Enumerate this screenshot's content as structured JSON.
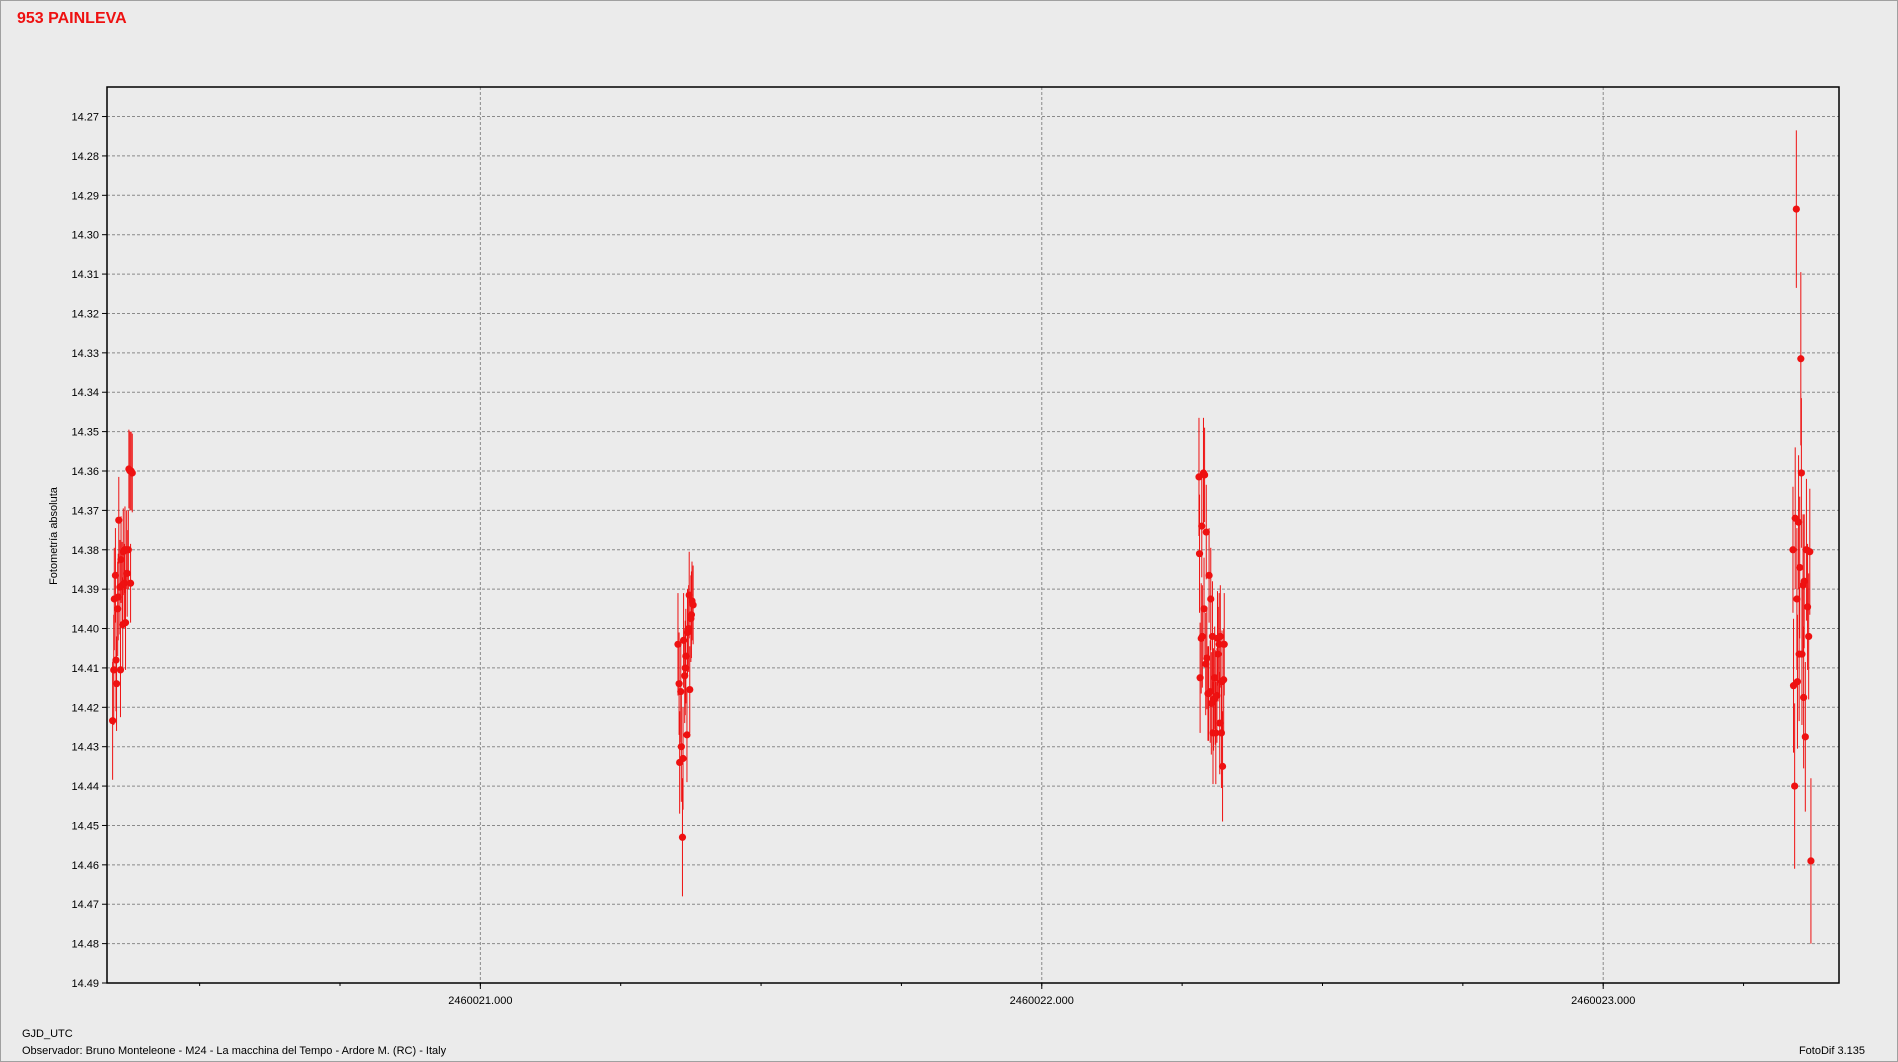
{
  "title": "953 PAINLEVA",
  "footer": {
    "xlabel": "GJD_UTC",
    "observer": "Observador: Bruno Monteleone - M24 - La macchina del Tempo - Ardore M. (RC) - Italy",
    "software": "FotoDif 3.135"
  },
  "chart_data": {
    "type": "scatter",
    "title": "953 PAINLEVA",
    "xlabel": "GJD_UTC",
    "ylabel": "Fotometría absoluta",
    "y_inverted": true,
    "grid": true,
    "xlim": [
      2460020.335,
      2460023.42
    ],
    "ylim": [
      14.2625,
      14.49
    ],
    "x_ticks": [
      2460021.0,
      2460022.0,
      2460023.0
    ],
    "x_tick_labels": [
      "2460021.000",
      "2460022.000",
      "2460023.000"
    ],
    "y_ticks": [
      14.27,
      14.28,
      14.29,
      14.3,
      14.31,
      14.32,
      14.33,
      14.34,
      14.35,
      14.36,
      14.37,
      14.38,
      14.39,
      14.4,
      14.41,
      14.42,
      14.43,
      14.44,
      14.45,
      14.46,
      14.47,
      14.48,
      14.49
    ],
    "y_tick_labels": [
      "14.27",
      "14.28",
      "14.29",
      "14.30",
      "14.31",
      "14.32",
      "14.33",
      "14.34",
      "14.35",
      "14.36",
      "14.37",
      "14.38",
      "14.39",
      "14.40",
      "14.41",
      "14.42",
      "14.43",
      "14.44",
      "14.45",
      "14.46",
      "14.47",
      "14.48",
      "14.49"
    ],
    "marker_color": "#ee1111",
    "series": [
      {
        "points": [
          [
            2460020.345,
            14.4234,
            0.015
          ],
          [
            2460020.347,
            14.4105,
            0.014
          ],
          [
            2460020.348,
            14.3925,
            0.013
          ],
          [
            2460020.35,
            14.3865,
            0.012
          ],
          [
            2460020.351,
            14.408,
            0.013
          ],
          [
            2460020.352,
            14.414,
            0.012
          ],
          [
            2460020.354,
            14.395,
            0.012
          ],
          [
            2460020.355,
            14.392,
            0.011
          ],
          [
            2460020.356,
            14.3725,
            0.011
          ],
          [
            2460020.358,
            14.3895,
            0.012
          ],
          [
            2460020.359,
            14.4105,
            0.012
          ],
          [
            2460020.36,
            14.3825,
            0.011
          ],
          [
            2460020.362,
            14.389,
            0.011
          ],
          [
            2460020.363,
            14.399,
            0.012
          ],
          [
            2460020.364,
            14.3805,
            0.011
          ],
          [
            2460020.366,
            14.3885,
            0.01
          ],
          [
            2460020.367,
            14.38,
            0.011
          ],
          [
            2460020.368,
            14.3985,
            0.012
          ],
          [
            2460020.37,
            14.38,
            0.01
          ],
          [
            2460020.371,
            14.386,
            0.011
          ],
          [
            2460020.373,
            14.38,
            0.01
          ],
          [
            2460020.374,
            14.3595,
            0.01
          ],
          [
            2460020.376,
            14.36,
            0.01
          ],
          [
            2460020.377,
            14.3885,
            0.01
          ],
          [
            2460020.378,
            14.36,
            0.01
          ],
          [
            2460020.38,
            14.3605,
            0.01
          ],
          [
            2460021.352,
            14.404,
            0.013
          ],
          [
            2460021.354,
            14.414,
            0.013
          ],
          [
            2460021.355,
            14.434,
            0.013
          ],
          [
            2460021.357,
            14.416,
            0.013
          ],
          [
            2460021.358,
            14.43,
            0.014
          ],
          [
            2460021.36,
            14.453,
            0.015
          ],
          [
            2460021.361,
            14.433,
            0.013
          ],
          [
            2460021.362,
            14.403,
            0.012
          ],
          [
            2460021.364,
            14.412,
            0.012
          ],
          [
            2460021.365,
            14.41,
            0.012
          ],
          [
            2460021.366,
            14.407,
            0.012
          ],
          [
            2460021.368,
            14.427,
            0.012
          ],
          [
            2460021.369,
            14.401,
            0.011
          ],
          [
            2460021.371,
            14.4,
            0.011
          ],
          [
            2460021.372,
            14.3915,
            0.011
          ],
          [
            2460021.373,
            14.4155,
            0.011
          ],
          [
            2460021.375,
            14.3975,
            0.011
          ],
          [
            2460021.376,
            14.3965,
            0.011
          ],
          [
            2460021.377,
            14.393,
            0.01
          ],
          [
            2460021.379,
            14.394,
            0.01
          ],
          [
            2460022.28,
            14.3615,
            0.015
          ],
          [
            2460022.281,
            14.381,
            0.015
          ],
          [
            2460022.282,
            14.4125,
            0.014
          ],
          [
            2460022.284,
            14.4025,
            0.014
          ],
          [
            2460022.285,
            14.374,
            0.013
          ],
          [
            2460022.286,
            14.402,
            0.013
          ],
          [
            2460022.288,
            14.3605,
            0.014
          ],
          [
            2460022.289,
            14.395,
            0.013
          ],
          [
            2460022.29,
            14.361,
            0.012
          ],
          [
            2460022.292,
            14.409,
            0.013
          ],
          [
            2460022.293,
            14.3755,
            0.012
          ],
          [
            2460022.294,
            14.4075,
            0.013
          ],
          [
            2460022.296,
            14.4165,
            0.012
          ],
          [
            2460022.297,
            14.4165,
            0.012
          ],
          [
            2460022.298,
            14.3865,
            0.012
          ],
          [
            2460022.3,
            14.416,
            0.013
          ],
          [
            2460022.301,
            14.3925,
            0.013
          ],
          [
            2460022.302,
            14.419,
            0.013
          ],
          [
            2460022.304,
            14.402,
            0.014
          ],
          [
            2460022.305,
            14.4265,
            0.013
          ],
          [
            2460022.306,
            14.418,
            0.013
          ],
          [
            2460022.308,
            14.4125,
            0.013
          ],
          [
            2460022.309,
            14.4175,
            0.012
          ],
          [
            2460022.31,
            14.4265,
            0.013
          ],
          [
            2460022.312,
            14.417,
            0.012
          ],
          [
            2460022.313,
            14.4025,
            0.012
          ],
          [
            2460022.314,
            14.4065,
            0.012
          ],
          [
            2460022.316,
            14.404,
            0.013
          ],
          [
            2460022.317,
            14.424,
            0.013
          ],
          [
            2460022.318,
            14.402,
            0.013
          ],
          [
            2460022.32,
            14.4265,
            0.014
          ],
          [
            2460022.321,
            14.4135,
            0.013
          ],
          [
            2460022.322,
            14.435,
            0.014
          ],
          [
            2460022.324,
            14.413,
            0.013
          ],
          [
            2460022.325,
            14.404,
            0.013
          ],
          [
            2460023.338,
            14.38,
            0.016
          ],
          [
            2460023.339,
            14.4145,
            0.017
          ],
          [
            2460023.341,
            14.44,
            0.021
          ],
          [
            2460023.342,
            14.372,
            0.018
          ],
          [
            2460023.344,
            14.2935,
            0.02
          ],
          [
            2460023.345,
            14.3925,
            0.018
          ],
          [
            2460023.346,
            14.4135,
            0.017
          ],
          [
            2460023.348,
            14.373,
            0.017
          ],
          [
            2460023.349,
            14.4065,
            0.017
          ],
          [
            2460023.35,
            14.3845,
            0.018
          ],
          [
            2460023.352,
            14.3315,
            0.022
          ],
          [
            2460023.353,
            14.3605,
            0.019
          ],
          [
            2460023.354,
            14.4065,
            0.018
          ],
          [
            2460023.356,
            14.389,
            0.018
          ],
          [
            2460023.357,
            14.4175,
            0.018
          ],
          [
            2460023.358,
            14.388,
            0.017
          ],
          [
            2460023.36,
            14.4275,
            0.019
          ],
          [
            2460023.362,
            14.38,
            0.018
          ],
          [
            2460023.364,
            14.3945,
            0.016
          ],
          [
            2460023.366,
            14.402,
            0.016
          ],
          [
            2460023.368,
            14.3805,
            0.016
          ],
          [
            2460023.37,
            14.459,
            0.021
          ]
        ]
      }
    ]
  }
}
